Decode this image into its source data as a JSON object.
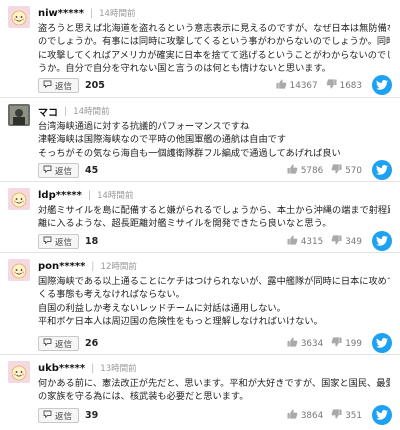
{
  "colors": {
    "accent": "#1da1f2",
    "thumb": "#a9a9a9",
    "avatar_bg": "#f4d8e2"
  },
  "comments": [
    {
      "user": "niw*****",
      "time": "14時間前",
      "avatar": "face-avatar",
      "lines": [
        "盗ろうと思えば北海道を盗れるという意志表示に見えるのですが、なぜ日本は無防備な",
        "のでしょうか。有事には同時に攻撃してくるという事がわからないのでしょうか。同時",
        "に攻撃してくればアメリカが確実に日本を捨てて逃げるということがわからないのでしょ",
        "うか。自分で自分を守れない国と言うのは何とも情けないと思います。"
      ],
      "reply_label": "返信",
      "reply_count": "205",
      "likes": "14367",
      "dislikes": "1683"
    },
    {
      "user": "マコ",
      "time": "14時間前",
      "avatar": "photo-avatar",
      "lines": [
        "台湾海峡通過に対する抗議的パフォーマンスですね",
        "津軽海峡は国際海峡なので平時の他国軍艦の通航は自由です",
        "そっちがその気なら海自も一個護衛隊群フル編成で通過してあげれば良い"
      ],
      "reply_label": "返信",
      "reply_count": "45",
      "likes": "5786",
      "dislikes": "570"
    },
    {
      "user": "ldp*****",
      "time": "14時間前",
      "avatar": "face-avatar",
      "lines": [
        "対艦ミサイルを島に配備すると嫌がられるでしょうから、本土から沖縄の端まで射程距",
        "離に入るような、超長距離対艦ミサイルを開発できたら良いなと思う。"
      ],
      "reply_label": "返信",
      "reply_count": "18",
      "likes": "4315",
      "dislikes": "349"
    },
    {
      "user": "pon*****",
      "time": "12時間前",
      "avatar": "face-avatar",
      "lines": [
        "国際海峡である以上通ることにケチはつけられないが、露中艦隊が同時に日本に攻めて",
        "くる事態も考えなければならない。",
        "自国の利益しか考えないレッドチームに対話は通用しない。",
        "平和ボケ日本人は周辺国の危険性をもっと理解しなければいけない。"
      ],
      "reply_label": "返信",
      "reply_count": "26",
      "likes": "3634",
      "dislikes": "199"
    },
    {
      "user": "ukb*****",
      "time": "13時間前",
      "avatar": "face-avatar",
      "lines": [
        "何かある前に、憲法改正が先だと、思います。平和が大好きですが、国家と国民、最愛",
        "の家族を守る為には、核武装も必要だと思います。"
      ],
      "reply_label": "返信",
      "reply_count": "39",
      "likes": "3864",
      "dislikes": "351"
    }
  ]
}
